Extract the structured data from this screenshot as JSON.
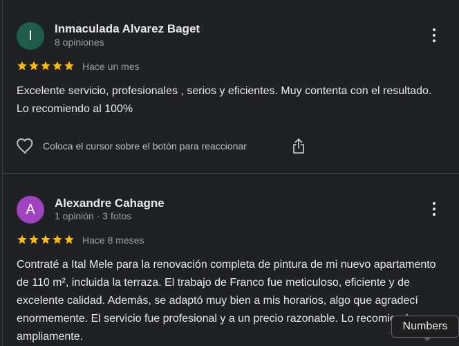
{
  "reviews": [
    {
      "avatar_letter": "I",
      "avatar_color": "#1f5c4a",
      "author": "Inmaculada Alvarez Baget",
      "meta": "8 opiniones",
      "rating": 5,
      "time_ago": "Hace un mes",
      "text": "Excelente servicio, profesionales , serios y eficientes. Muy contenta con el resultado. Lo recomiendo al 100%",
      "react_hint": "Coloca el cursor sobre el botón para reaccionar"
    },
    {
      "avatar_letter": "A",
      "avatar_color": "#a143c0",
      "author": "Alexandre Cahagne",
      "meta": "1 opinión · 3 fotos",
      "rating": 5,
      "time_ago": "Hace 8 meses",
      "text": "Contraté a Ital Mele para la renovación completa de pintura de mi nuevo apartamento de 110 m², incluida la terraza. El trabajo de Franco fue meticuloso, eficiente y de excelente calidad. Además, se adaptó muy bien a mis horarios, algo que agradecí enormemente. El servicio fue profesional y a un precio razonable. Lo recomiendo ampliamente."
    }
  ],
  "tooltip": {
    "label": "Numbers"
  },
  "colors": {
    "background": "#202124",
    "star": "#fbbc04",
    "text": "#e8eaed",
    "secondary_text": "#9aa0a6"
  },
  "icons": {
    "more": "more-vertical-icon",
    "star": "star-icon",
    "like": "heart-outline-icon",
    "share": "share-icon"
  }
}
